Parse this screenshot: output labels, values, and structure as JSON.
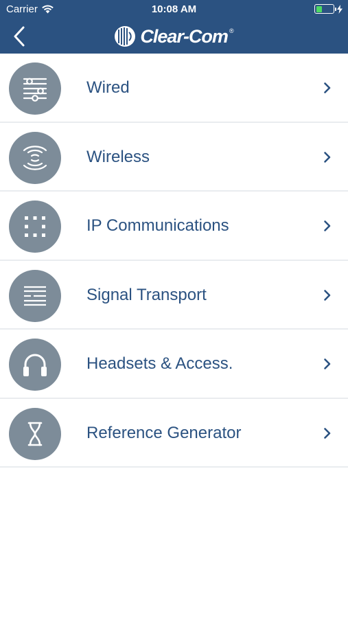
{
  "status_bar": {
    "carrier": "Carrier",
    "time": "10:08 AM",
    "battery_level": 0.35
  },
  "nav_bar": {
    "back_icon": "chevron-left-icon",
    "brand": "Clear-Com",
    "brand_mark": "®"
  },
  "menu": {
    "items": [
      {
        "label": "Wired",
        "icon": "sliders-icon"
      },
      {
        "label": "Wireless",
        "icon": "wireless-signal-icon"
      },
      {
        "label": "IP Communications",
        "icon": "dot-grid-icon"
      },
      {
        "label": "Signal Transport",
        "icon": "signal-lines-icon"
      },
      {
        "label": "Headsets & Access.",
        "icon": "headset-icon"
      },
      {
        "label": "Reference Generator",
        "icon": "hourglass-icon"
      }
    ]
  },
  "colors": {
    "header": "#2b5281",
    "icon_circle": "#7d8c99",
    "label": "#2b5281",
    "divider": "#e9ecef"
  }
}
